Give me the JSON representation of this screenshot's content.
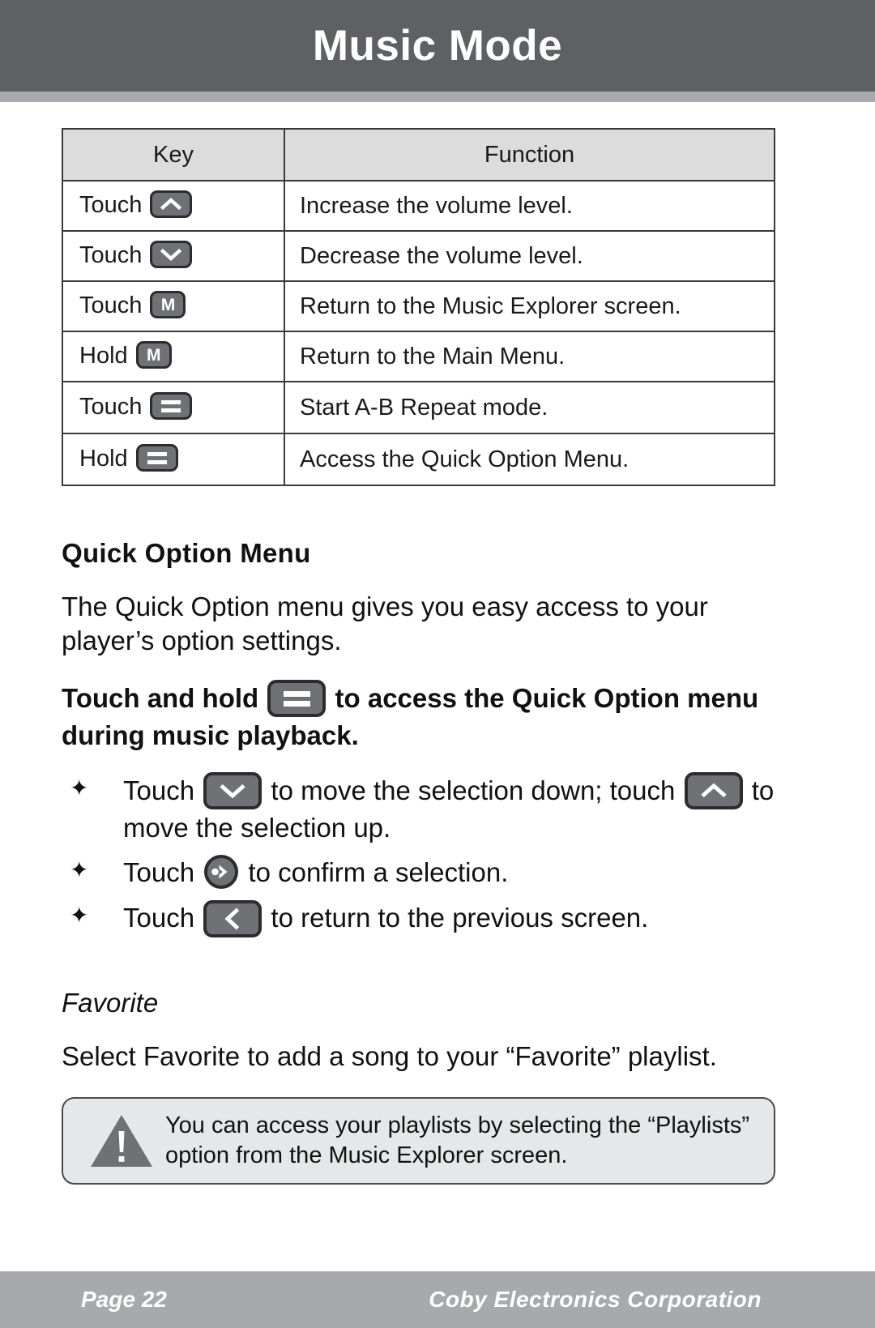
{
  "header": {
    "title": "Music Mode"
  },
  "key_table": {
    "columns": [
      "Key",
      "Function"
    ],
    "rows": [
      {
        "action": "Touch",
        "icon": "volume-up-icon",
        "function": "Increase the volume level."
      },
      {
        "action": "Touch",
        "icon": "volume-down-icon",
        "function": "Decrease the volume level."
      },
      {
        "action": "Touch",
        "icon": "m-key-icon",
        "function": "Return to the Music Explorer screen."
      },
      {
        "action": "Hold",
        "icon": "m-key-icon",
        "function": "Return to the Main Menu."
      },
      {
        "action": "Touch",
        "icon": "menu-bars-icon",
        "function": "Start A-B Repeat mode."
      },
      {
        "action": "Hold",
        "icon": "menu-bars-icon",
        "function": "Access the Quick Option Menu."
      }
    ]
  },
  "quick_option": {
    "heading": "Quick Option Menu",
    "intro": "The Quick Option menu gives you easy access to your player’s option settings.",
    "instruction_before": "Touch and hold",
    "instruction_icon": "menu-bars-icon",
    "instruction_after": "to access the Quick Option menu during music playback.",
    "bullet_glyph": "✦",
    "bullets": [
      {
        "part1": "Touch",
        "icon1": "chevron-down-icon",
        "part2": "to move the selection down; touch",
        "icon2": "chevron-up-icon",
        "part3": "to move the selection up."
      },
      {
        "part1": "Touch",
        "icon1": "confirm-play-icon",
        "part2": "to confirm a selection.",
        "icon2": "",
        "part3": ""
      },
      {
        "part1": "Touch",
        "icon1": "chevron-left-icon",
        "part2": "to return to the previous screen.",
        "icon2": "",
        "part3": ""
      }
    ]
  },
  "favorite": {
    "heading": "Favorite",
    "text": "Select Favorite to add a song to your “Favorite” playlist."
  },
  "note": {
    "icon": "warning-triangle-icon",
    "text": "You can access your playlists by selecting the “Playlists” option from the Music Explorer screen."
  },
  "footer": {
    "page_label": "Page 22",
    "company": "Coby Electronics Corporation"
  },
  "colors": {
    "header_bar": "#5e6064",
    "header_strip": "#a7a9ac",
    "table_header_fill": "#dcdcdc",
    "key_button_fill": "#6f7175",
    "key_button_border": "#2c2b30",
    "note_fill": "#e6e7e8",
    "footer_bar": "#a7a9ac",
    "text": "#111111"
  }
}
